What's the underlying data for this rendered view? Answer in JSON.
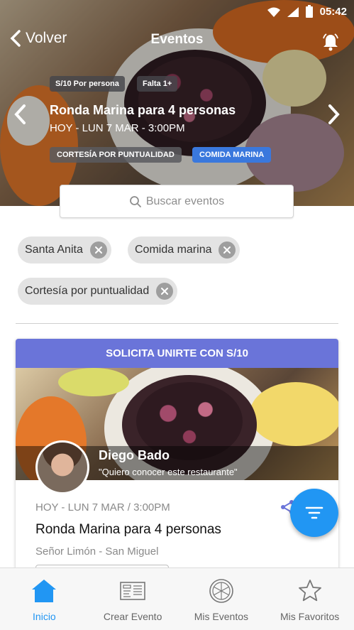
{
  "status_bar": {
    "time": "05:42"
  },
  "app_bar": {
    "back_label": "Volver",
    "title": "Eventos"
  },
  "featured": {
    "price": "S/10 Por persona",
    "missing": "Falta 1+",
    "title": "Ronda Marina para 4 personas",
    "date": "HOY - LUN 7 MAR  - 3:00PM",
    "tags": [
      "CORTESÍA POR PUNTUALIDAD",
      "COMIDA MARINA"
    ]
  },
  "search": {
    "placeholder": "Buscar eventos"
  },
  "filters": [
    "Santa Anita",
    "Comida marina",
    "Cortesía por puntualidad"
  ],
  "event_card": {
    "header": "SOLICITA UNIRTE CON S/10",
    "host_name": "Diego Bado",
    "host_quote": "\"Quiero conocer este restaurante\"",
    "date": "HOY - LUN 7 MAR / 3:00PM",
    "title": "Ronda Marina para 4 personas",
    "place": "Señor Limón - San Miguel"
  },
  "bottom_nav": [
    {
      "label": "Inicio",
      "icon": "home-icon",
      "active": true
    },
    {
      "label": "Crear Evento",
      "icon": "create-event-icon",
      "active": false
    },
    {
      "label": "Mis Eventos",
      "icon": "pizza-icon",
      "active": false
    },
    {
      "label": "Mis Favoritos",
      "icon": "star-icon",
      "active": false
    }
  ],
  "colors": {
    "accent": "#2196f3",
    "card_header": "#6a74d9",
    "tag_blue": "#3a78dd"
  }
}
